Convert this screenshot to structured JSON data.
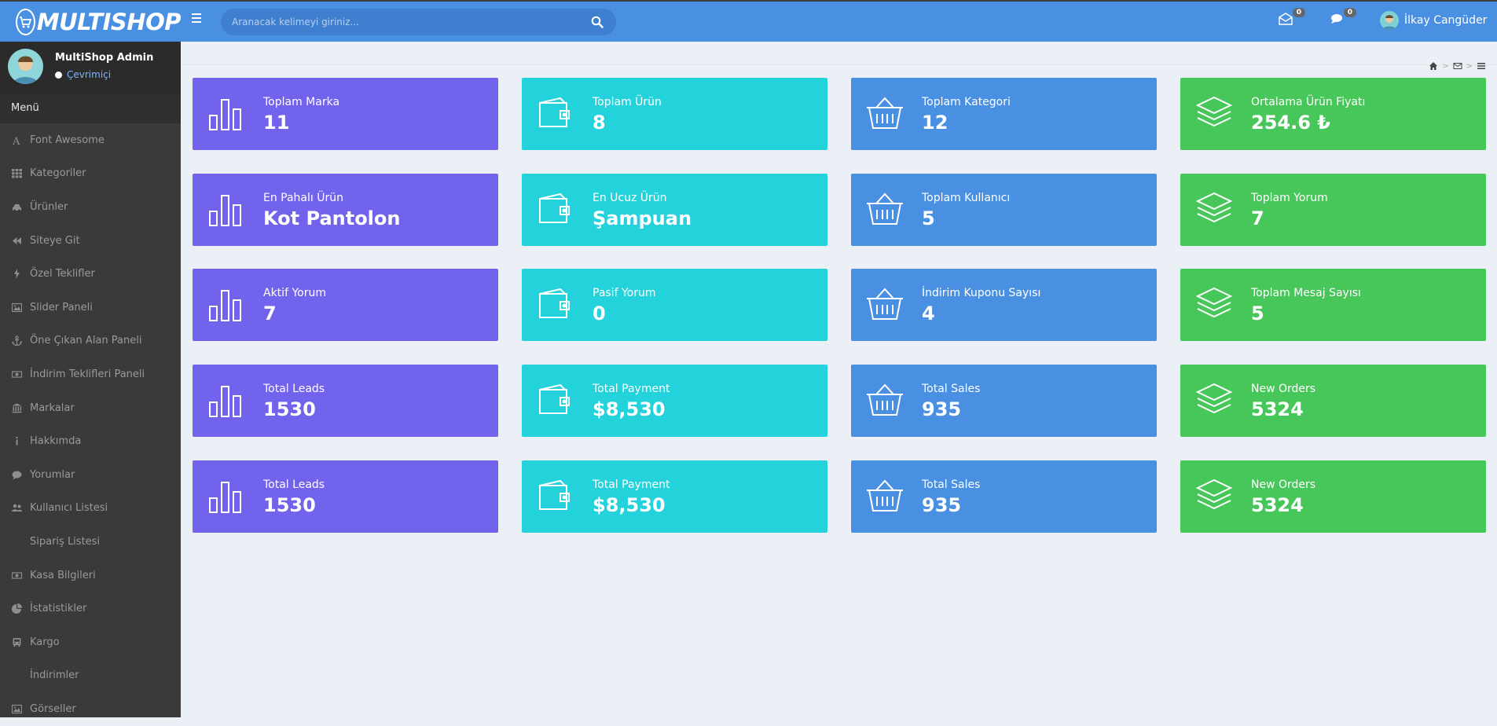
{
  "brand": {
    "name": "MULTISHOP"
  },
  "topbar": {
    "search_placeholder": "Aranacak kelimeyi giriniz...",
    "mail_count": "0",
    "chat_count": "0",
    "user_name": "İlkay Cangüder"
  },
  "sidebar": {
    "admin_name": "MultiShop Admin",
    "status": "Çevrimiçi",
    "menu_title": "Menü",
    "items": [
      {
        "label": "Font Awesome",
        "icon": "font-icon"
      },
      {
        "label": "Kategoriler",
        "icon": "grid-icon"
      },
      {
        "label": "Ürünler",
        "icon": "car-icon"
      },
      {
        "label": "Siteye Git",
        "icon": "backward-icon"
      },
      {
        "label": "Özel Teklifler",
        "icon": "bolt-icon"
      },
      {
        "label": "Slider Paneli",
        "icon": "image-icon"
      },
      {
        "label": "Öne Çıkan Alan Paneli",
        "icon": "anchor-icon"
      },
      {
        "label": "İndirim Teklifleri Paneli",
        "icon": "money-icon"
      },
      {
        "label": "Markalar",
        "icon": "bank-icon"
      },
      {
        "label": "Hakkımda",
        "icon": "info-icon"
      },
      {
        "label": "Yorumlar",
        "icon": "comment-icon"
      },
      {
        "label": "Kullanıcı Listesi",
        "icon": "users-icon"
      },
      {
        "label": "Sipariş Listesi",
        "icon": ""
      },
      {
        "label": "Kasa Bilgileri",
        "icon": "money-icon"
      },
      {
        "label": "İstatistikler",
        "icon": "pie-chart-icon"
      },
      {
        "label": "Kargo",
        "icon": "bus-icon"
      },
      {
        "label": "İndirimler",
        "icon": ""
      },
      {
        "label": "Görseller",
        "icon": "image-icon"
      }
    ]
  },
  "cards": [
    [
      {
        "title": "Toplam Marka",
        "value": "11",
        "color": "#7163ec",
        "icon": "bar-chart-icon"
      },
      {
        "title": "Toplam Ürün",
        "value": "8",
        "color": "#23d2da",
        "icon": "wallet-icon"
      },
      {
        "title": "Toplam Kategori",
        "value": "12",
        "color": "#4a90e2",
        "icon": "basket-icon"
      },
      {
        "title": "Ortalama Ürün Fiyatı",
        "value": "254.6 ₺",
        "color": "#47c65a",
        "icon": "layers-icon"
      }
    ],
    [
      {
        "title": "En Pahalı Ürün",
        "value": "Kot Pantolon",
        "color": "#7163ec",
        "icon": "bar-chart-icon"
      },
      {
        "title": "En Ucuz Ürün",
        "value": "Şampuan",
        "color": "#23d2da",
        "icon": "wallet-icon"
      },
      {
        "title": "Toplam Kullanıcı",
        "value": "5",
        "color": "#4a90e2",
        "icon": "basket-icon"
      },
      {
        "title": "Toplam Yorum",
        "value": "7",
        "color": "#47c65a",
        "icon": "layers-icon"
      }
    ],
    [
      {
        "title": "Aktif Yorum",
        "value": "7",
        "color": "#7163ec",
        "icon": "bar-chart-icon"
      },
      {
        "title": "Pasif Yorum",
        "value": "0",
        "color": "#23d2da",
        "icon": "wallet-icon"
      },
      {
        "title": "İndirim Kuponu Sayısı",
        "value": "4",
        "color": "#4a90e2",
        "icon": "basket-icon"
      },
      {
        "title": "Toplam Mesaj Sayısı",
        "value": "5",
        "color": "#47c65a",
        "icon": "layers-icon"
      }
    ],
    [
      {
        "title": "Total Leads",
        "value": "1530",
        "color": "#7163ec",
        "icon": "bar-chart-icon"
      },
      {
        "title": "Total Payment",
        "value": "$8,530",
        "color": "#23d2da",
        "icon": "wallet-icon"
      },
      {
        "title": "Total Sales",
        "value": "935",
        "color": "#4a90e2",
        "icon": "basket-icon"
      },
      {
        "title": "New Orders",
        "value": "5324",
        "color": "#47c65a",
        "icon": "layers-icon"
      }
    ],
    [
      {
        "title": "Total Leads",
        "value": "1530",
        "color": "#7163ec",
        "icon": "bar-chart-icon"
      },
      {
        "title": "Total Payment",
        "value": "$8,530",
        "color": "#23d2da",
        "icon": "wallet-icon"
      },
      {
        "title": "Total Sales",
        "value": "935",
        "color": "#4a90e2",
        "icon": "basket-icon"
      },
      {
        "title": "New Orders",
        "value": "5324",
        "color": "#47c65a",
        "icon": "layers-icon"
      }
    ]
  ]
}
